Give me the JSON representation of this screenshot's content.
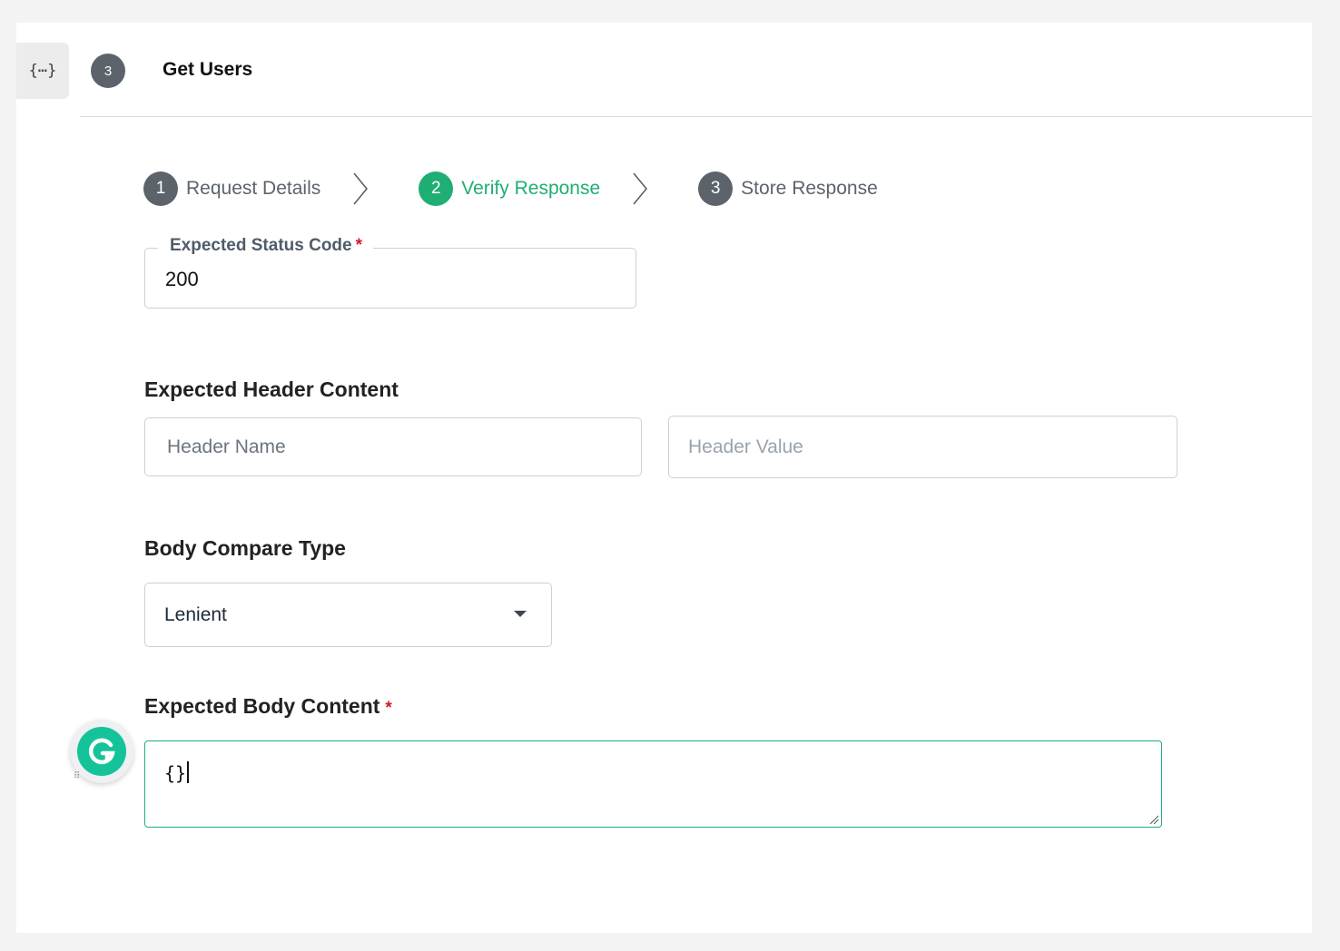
{
  "header": {
    "icon": "curly-braces-icon",
    "icon_glyph": "{⋯}",
    "step_count": "3",
    "title": "Get Users"
  },
  "stepper": {
    "steps": [
      {
        "number": "1",
        "label": "Request Details",
        "state": "inactive"
      },
      {
        "number": "2",
        "label": "Verify Response",
        "state": "active"
      },
      {
        "number": "3",
        "label": "Store Response",
        "state": "inactive"
      }
    ],
    "active_color": "#1fae74",
    "inactive_color": "#5c636b"
  },
  "status_code": {
    "label": "Expected Status Code",
    "required_mark": "*",
    "value": "200"
  },
  "header_content": {
    "label": "Expected Header Content",
    "name_placeholder": "Header Name",
    "value_placeholder": "Header Value"
  },
  "body_compare": {
    "label": "Body Compare Type",
    "selected": "Lenient"
  },
  "body_content": {
    "label": "Expected Body Content",
    "required_mark": "*",
    "value": "{}"
  },
  "overlay": {
    "icon": "grammarly-icon",
    "letter": "G",
    "color": "#15c39a"
  }
}
